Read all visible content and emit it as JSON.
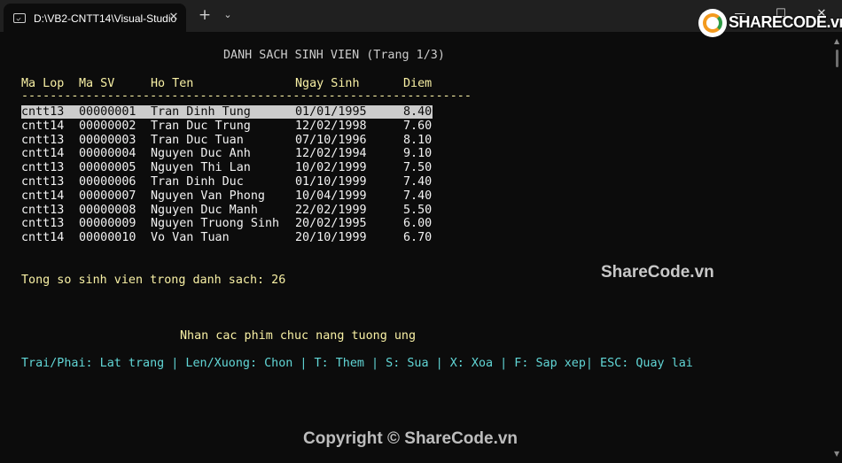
{
  "window": {
    "tab_title": "D:\\VB2-CNTT14\\Visual-Studio",
    "tab_icon": "console-icon",
    "close_glyph": "✕",
    "newtab_glyph": "+",
    "dropdown_glyph": "⌄",
    "minimize_glyph": "—",
    "maximize_glyph": "☐",
    "close_window_glyph": "✕"
  },
  "console": {
    "title": "DANH SACH SINH VIEN (Trang 1/3)",
    "headers": [
      "Ma Lop",
      "Ma SV",
      "Ho Ten",
      "Ngay Sinh",
      "Diem"
    ],
    "separator": "---------------------------------------------------------------",
    "rows": [
      {
        "ma_lop": "cntt13",
        "ma_sv": "00000001",
        "ho_ten": "Tran Dinh Tung",
        "ngay_sinh": "01/01/1995",
        "diem": "8.40",
        "selected": true
      },
      {
        "ma_lop": "cntt14",
        "ma_sv": "00000002",
        "ho_ten": "Tran Duc Trung",
        "ngay_sinh": "12/02/1998",
        "diem": "7.60"
      },
      {
        "ma_lop": "cntt13",
        "ma_sv": "00000003",
        "ho_ten": "Tran Duc Tuan",
        "ngay_sinh": "07/10/1996",
        "diem": "8.10"
      },
      {
        "ma_lop": "cntt14",
        "ma_sv": "00000004",
        "ho_ten": "Nguyen Duc Anh",
        "ngay_sinh": "12/02/1994",
        "diem": "9.10"
      },
      {
        "ma_lop": "cntt13",
        "ma_sv": "00000005",
        "ho_ten": "Nguyen Thi Lan",
        "ngay_sinh": "10/02/1999",
        "diem": "7.50"
      },
      {
        "ma_lop": "cntt13",
        "ma_sv": "00000006",
        "ho_ten": "Tran Dinh Duc",
        "ngay_sinh": "01/10/1999",
        "diem": "7.40"
      },
      {
        "ma_lop": "cntt14",
        "ma_sv": "00000007",
        "ho_ten": "Nguyen Van Phong",
        "ngay_sinh": "10/04/1999",
        "diem": "7.40"
      },
      {
        "ma_lop": "cntt13",
        "ma_sv": "00000008",
        "ho_ten": "Nguyen Duc Manh",
        "ngay_sinh": "22/02/1999",
        "diem": "5.50"
      },
      {
        "ma_lop": "cntt13",
        "ma_sv": "00000009",
        "ho_ten": "Nguyen Truong Sinh",
        "ngay_sinh": "20/02/1995",
        "diem": "6.00"
      },
      {
        "ma_lop": "cntt14",
        "ma_sv": "00000010",
        "ho_ten": "Vo Van Tuan",
        "ngay_sinh": "20/10/1999",
        "diem": "6.70"
      }
    ],
    "total_text": "Tong so sinh vien trong danh sach: 26",
    "prompt_text": "Nhan cac phim chuc nang tuong ung",
    "help_text": "Trai/Phai: Lat trang | Len/Xuong: Chon | T: Them | S: Sua | X: Xoa | F: Sap xep| ESC: Quay lai"
  },
  "watermarks": {
    "logo_text": "SHARECODE.vn",
    "mid": "ShareCode.vn",
    "bottom": "Copyright © ShareCode.vn"
  },
  "colors": {
    "background": "#0c0c0c",
    "heading_yellow": "#f9f1a5",
    "help_cyan": "#61d6d6",
    "selection_bg": "#cccccc"
  }
}
